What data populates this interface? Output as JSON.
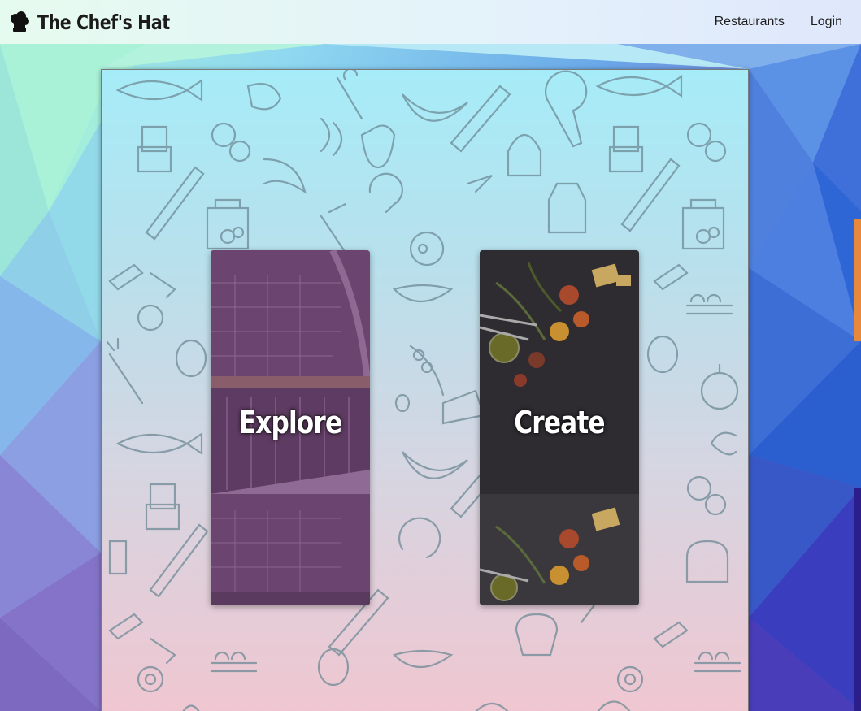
{
  "nav": {
    "brand_name": "The Chef's Hat",
    "brand_icon": "chef-hat-icon",
    "links": [
      {
        "label": "Restaurants"
      },
      {
        "label": "Login"
      }
    ]
  },
  "cards": [
    {
      "label": "Explore"
    },
    {
      "label": "Create"
    }
  ],
  "colors": {
    "explore_tint": "#6e4a74",
    "create_tint": "#2d2b30"
  }
}
